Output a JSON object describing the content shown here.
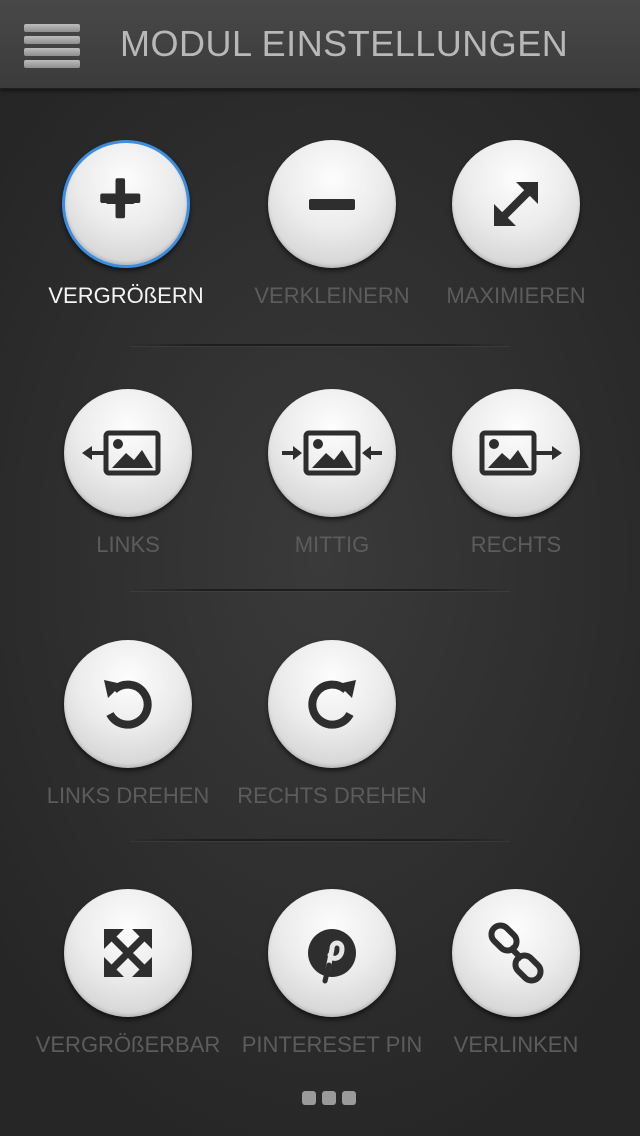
{
  "header": {
    "title": "MODUL EINSTELLUNGEN",
    "menu_icon": "hamburger-menu-icon"
  },
  "colors": {
    "accent": "#3b8ee0",
    "active_label": "#f4f4f4",
    "inactive_label": "#5c5c5c",
    "icon": "#2e2e2e"
  },
  "rows": [
    {
      "items": [
        {
          "label": "VERGRÖßERN",
          "icon": "plus-icon",
          "selected": true
        },
        {
          "label": "VERKLEINERN",
          "icon": "minus-icon",
          "selected": false
        },
        {
          "label": "MAXIMIEREN",
          "icon": "diagonal-expand-icon",
          "selected": false
        }
      ]
    },
    {
      "items": [
        {
          "label": "LINKS",
          "icon": "image-align-left-icon",
          "selected": false
        },
        {
          "label": "MITTIG",
          "icon": "image-align-center-icon",
          "selected": false
        },
        {
          "label": "RECHTS",
          "icon": "image-align-right-icon",
          "selected": false
        }
      ]
    },
    {
      "items": [
        {
          "label": "LINKS DREHEN",
          "icon": "rotate-left-icon",
          "selected": false
        },
        {
          "label": "RECHTS DREHEN",
          "icon": "rotate-right-icon",
          "selected": false
        }
      ]
    },
    {
      "items": [
        {
          "label": "VERGRÖßERBAR",
          "icon": "fullscreen-arrows-icon",
          "selected": false
        },
        {
          "label": "PINTERESET PIN",
          "icon": "pinterest-icon",
          "selected": false
        },
        {
          "label": "VERLINKEN",
          "icon": "link-chain-icon",
          "selected": false
        }
      ]
    }
  ],
  "pager": {
    "pages": 3
  }
}
